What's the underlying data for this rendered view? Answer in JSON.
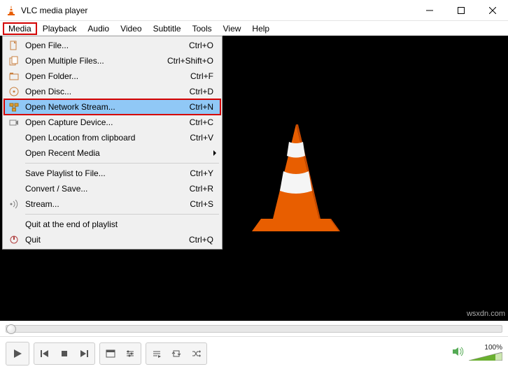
{
  "window": {
    "title": "VLC media player"
  },
  "menubar": {
    "items": [
      {
        "label": "Media",
        "highlighted": true
      },
      {
        "label": "Playback"
      },
      {
        "label": "Audio"
      },
      {
        "label": "Video"
      },
      {
        "label": "Subtitle"
      },
      {
        "label": "Tools"
      },
      {
        "label": "View"
      },
      {
        "label": "Help"
      }
    ]
  },
  "media_menu": {
    "rows": [
      {
        "icon": "file-icon",
        "label": "Open File...",
        "shortcut": "Ctrl+O"
      },
      {
        "icon": "multifile-icon",
        "label": "Open Multiple Files...",
        "shortcut": "Ctrl+Shift+O"
      },
      {
        "icon": "folder-icon",
        "label": "Open Folder...",
        "shortcut": "Ctrl+F"
      },
      {
        "icon": "disc-icon",
        "label": "Open Disc...",
        "shortcut": "Ctrl+D"
      },
      {
        "icon": "network-icon",
        "label": "Open Network Stream...",
        "shortcut": "Ctrl+N",
        "highlighted": true,
        "redbox": true
      },
      {
        "icon": "capture-icon",
        "label": "Open Capture Device...",
        "shortcut": "Ctrl+C"
      },
      {
        "icon": null,
        "label": "Open Location from clipboard",
        "shortcut": "Ctrl+V"
      },
      {
        "icon": null,
        "label": "Open Recent Media",
        "submenu": true
      },
      {
        "sep": true
      },
      {
        "icon": null,
        "label": "Save Playlist to File...",
        "shortcut": "Ctrl+Y"
      },
      {
        "icon": null,
        "label": "Convert / Save...",
        "shortcut": "Ctrl+R"
      },
      {
        "icon": "stream-icon",
        "label": "Stream...",
        "shortcut": "Ctrl+S"
      },
      {
        "sep": true
      },
      {
        "icon": null,
        "label": "Quit at the end of playlist"
      },
      {
        "icon": "quit-icon",
        "label": "Quit",
        "shortcut": "Ctrl+Q"
      }
    ]
  },
  "controls": {
    "volume_pct": "100%"
  },
  "watermark": "wsxdn.com"
}
